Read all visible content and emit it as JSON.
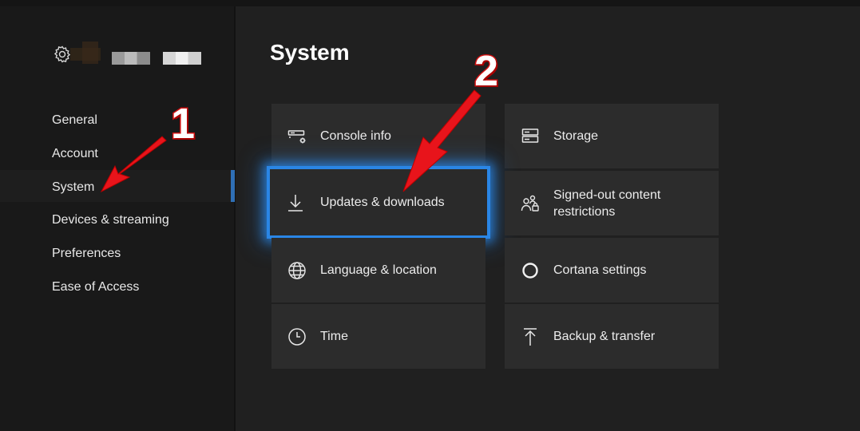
{
  "sidebar": {
    "items": [
      {
        "label": "General"
      },
      {
        "label": "Account"
      },
      {
        "label": "System"
      },
      {
        "label": "Devices & streaming"
      },
      {
        "label": "Preferences"
      },
      {
        "label": "Ease of Access"
      }
    ],
    "selected": "System"
  },
  "main": {
    "title": "System",
    "tiles": [
      {
        "label": "Console info",
        "icon": "console-info-icon"
      },
      {
        "label": "Storage",
        "icon": "storage-icon"
      },
      {
        "label": "Updates & downloads",
        "icon": "download-icon",
        "focused": true
      },
      {
        "label": "Signed-out content restrictions",
        "icon": "people-lock-icon"
      },
      {
        "label": "Language & location",
        "icon": "globe-icon"
      },
      {
        "label": "Cortana settings",
        "icon": "cortana-circle-icon"
      },
      {
        "label": "Time",
        "icon": "clock-icon"
      },
      {
        "label": "Backup & transfer",
        "icon": "upload-icon"
      }
    ]
  },
  "annotations": {
    "step1": "1",
    "step2": "2",
    "arrow_color": "#e8141b"
  },
  "colors": {
    "focus": "#2a86e6",
    "tile_bg": "#2c2c2c",
    "background": "#202020"
  }
}
